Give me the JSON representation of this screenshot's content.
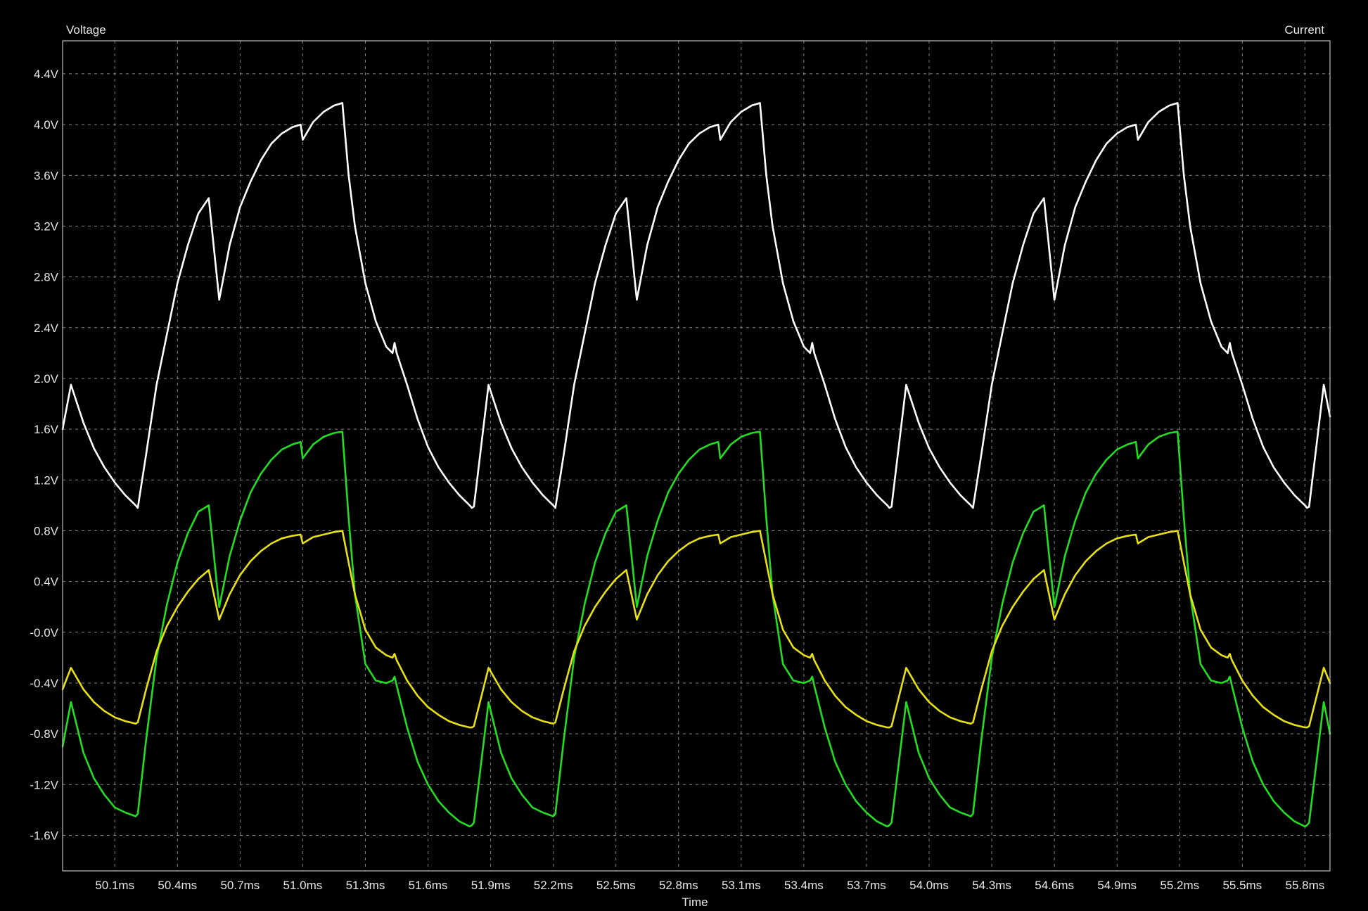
{
  "chart_data": {
    "type": "line",
    "title": "",
    "xlabel": "Time",
    "ylabel": "Voltage",
    "y2label": "Current",
    "xlim": [
      49.85,
      55.92
    ],
    "ylim": [
      -1.88,
      4.66
    ],
    "grid": true,
    "background": "#000000",
    "xticks": [
      50.1,
      50.4,
      50.7,
      51.0,
      51.3,
      51.6,
      51.9,
      52.2,
      52.5,
      52.8,
      53.1,
      53.4,
      53.7,
      54.0,
      54.3,
      54.6,
      54.9,
      55.2,
      55.5,
      55.8
    ],
    "xtick_labels": [
      "50.1ms",
      "50.4ms",
      "50.7ms",
      "51.0ms",
      "51.3ms",
      "51.6ms",
      "51.9ms",
      "52.2ms",
      "52.5ms",
      "52.8ms",
      "53.1ms",
      "53.4ms",
      "53.7ms",
      "54.0ms",
      "54.3ms",
      "54.6ms",
      "54.9ms",
      "55.2ms",
      "55.5ms",
      "55.8ms"
    ],
    "yticks": [
      4.4,
      4.0,
      3.6,
      3.2,
      2.8,
      2.4,
      2.0,
      1.6,
      1.2,
      0.8,
      0.4,
      0.0,
      -0.4,
      -0.8,
      -1.2,
      -1.6
    ],
    "ytick_labels": [
      "4.4V",
      "4.0V",
      "3.6V",
      "3.2V",
      "2.8V",
      "2.4V",
      "2.0V",
      "1.6V",
      "1.2V",
      "0.8V",
      "0.4V",
      "-0.0V",
      "-0.4V",
      "-0.8V",
      "-1.2V",
      "-1.6V"
    ],
    "series": [
      {
        "color": "#ffffff",
        "x": [
          49.85,
          49.89,
          49.95,
          50.0,
          50.05,
          50.1,
          50.15,
          50.2,
          50.21,
          50.25,
          50.3,
          50.35,
          50.4,
          50.45,
          50.5,
          50.55,
          50.6,
          50.65,
          50.7,
          50.75,
          50.8,
          50.85,
          50.9,
          50.95,
          50.99,
          51.0,
          51.05,
          51.1,
          51.15,
          51.19,
          51.22,
          51.25,
          51.3,
          51.35,
          51.4,
          51.43,
          51.44,
          51.45,
          51.5,
          51.55,
          51.6,
          51.65,
          51.7,
          51.75,
          51.8,
          51.81,
          51.82,
          51.89,
          51.95,
          52.0,
          52.05,
          52.1,
          52.15,
          52.2,
          52.21,
          52.25,
          52.3,
          52.35,
          52.4,
          52.45,
          52.5,
          52.55,
          52.6,
          52.65,
          52.7,
          52.75,
          52.8,
          52.85,
          52.9,
          52.95,
          52.99,
          53.0,
          53.05,
          53.1,
          53.15,
          53.19,
          53.22,
          53.25,
          53.3,
          53.35,
          53.4,
          53.43,
          53.44,
          53.45,
          53.5,
          53.55,
          53.6,
          53.65,
          53.7,
          53.75,
          53.8,
          53.81,
          53.82,
          53.89,
          53.95,
          54.0,
          54.05,
          54.1,
          54.15,
          54.2,
          54.21,
          54.25,
          54.3,
          54.35,
          54.4,
          54.45,
          54.5,
          54.55,
          54.6,
          54.65,
          54.7,
          54.75,
          54.8,
          54.85,
          54.9,
          54.95,
          54.99,
          55.0,
          55.05,
          55.1,
          55.15,
          55.19,
          55.22,
          55.25,
          55.3,
          55.35,
          55.4,
          55.43,
          55.44,
          55.45,
          55.5,
          55.55,
          55.6,
          55.65,
          55.7,
          55.75,
          55.8,
          55.81,
          55.82,
          55.89,
          55.92
        ],
        "y": [
          1.6,
          1.95,
          1.65,
          1.45,
          1.3,
          1.18,
          1.08,
          1.0,
          0.98,
          1.4,
          1.95,
          2.35,
          2.75,
          3.05,
          3.3,
          3.42,
          2.62,
          3.05,
          3.35,
          3.55,
          3.72,
          3.85,
          3.93,
          3.98,
          4.0,
          3.88,
          4.02,
          4.1,
          4.15,
          4.17,
          3.6,
          3.2,
          2.75,
          2.45,
          2.25,
          2.2,
          2.28,
          2.2,
          1.95,
          1.68,
          1.46,
          1.3,
          1.18,
          1.08,
          1.0,
          0.98,
          0.99,
          1.95,
          1.65,
          1.45,
          1.3,
          1.18,
          1.08,
          1.0,
          0.98,
          1.4,
          1.95,
          2.35,
          2.75,
          3.05,
          3.3,
          3.42,
          2.62,
          3.05,
          3.35,
          3.55,
          3.72,
          3.85,
          3.93,
          3.98,
          4.0,
          3.88,
          4.02,
          4.1,
          4.15,
          4.17,
          3.6,
          3.2,
          2.75,
          2.45,
          2.25,
          2.2,
          2.28,
          2.2,
          1.95,
          1.68,
          1.46,
          1.3,
          1.18,
          1.08,
          1.0,
          0.98,
          0.99,
          1.95,
          1.65,
          1.45,
          1.3,
          1.18,
          1.08,
          1.0,
          0.98,
          1.4,
          1.95,
          2.35,
          2.75,
          3.05,
          3.3,
          3.42,
          2.62,
          3.05,
          3.35,
          3.55,
          3.72,
          3.85,
          3.93,
          3.98,
          4.0,
          3.88,
          4.02,
          4.1,
          4.15,
          4.17,
          3.6,
          3.2,
          2.75,
          2.45,
          2.25,
          2.2,
          2.28,
          2.2,
          1.95,
          1.68,
          1.46,
          1.3,
          1.18,
          1.08,
          1.0,
          0.98,
          0.99,
          1.95,
          1.7
        ]
      },
      {
        "color": "#22dd22",
        "x": [
          49.85,
          49.89,
          49.95,
          50.0,
          50.05,
          50.1,
          50.15,
          50.2,
          50.21,
          50.25,
          50.3,
          50.35,
          50.4,
          50.45,
          50.5,
          50.55,
          50.6,
          50.65,
          50.7,
          50.75,
          50.8,
          50.85,
          50.9,
          50.95,
          50.99,
          51.0,
          51.05,
          51.1,
          51.15,
          51.19,
          51.22,
          51.25,
          51.3,
          51.35,
          51.4,
          51.43,
          51.44,
          51.45,
          51.5,
          51.55,
          51.6,
          51.65,
          51.7,
          51.75,
          51.8,
          51.81,
          51.82,
          51.89,
          51.95,
          52.0,
          52.05,
          52.1,
          52.15,
          52.2,
          52.21,
          52.25,
          52.3,
          52.35,
          52.4,
          52.45,
          52.5,
          52.55,
          52.6,
          52.65,
          52.7,
          52.75,
          52.8,
          52.85,
          52.9,
          52.95,
          52.99,
          53.0,
          53.05,
          53.1,
          53.15,
          53.19,
          53.22,
          53.25,
          53.3,
          53.35,
          53.4,
          53.43,
          53.44,
          53.45,
          53.5,
          53.55,
          53.6,
          53.65,
          53.7,
          53.75,
          53.8,
          53.81,
          53.82,
          53.89,
          53.95,
          54.0,
          54.05,
          54.1,
          54.15,
          54.2,
          54.21,
          54.25,
          54.3,
          54.35,
          54.4,
          54.45,
          54.5,
          54.55,
          54.6,
          54.65,
          54.7,
          54.75,
          54.8,
          54.85,
          54.9,
          54.95,
          54.99,
          55.0,
          55.05,
          55.1,
          55.15,
          55.19,
          55.22,
          55.25,
          55.3,
          55.35,
          55.4,
          55.43,
          55.44,
          55.45,
          55.5,
          55.55,
          55.6,
          55.65,
          55.7,
          55.75,
          55.8,
          55.81,
          55.82,
          55.89,
          55.92
        ],
        "y": [
          -0.9,
          -0.55,
          -0.95,
          -1.15,
          -1.28,
          -1.38,
          -1.42,
          -1.45,
          -1.43,
          -0.85,
          -0.2,
          0.22,
          0.55,
          0.78,
          0.95,
          1.0,
          0.2,
          0.6,
          0.88,
          1.1,
          1.25,
          1.36,
          1.44,
          1.48,
          1.5,
          1.37,
          1.48,
          1.54,
          1.57,
          1.58,
          0.9,
          0.3,
          -0.25,
          -0.38,
          -0.4,
          -0.38,
          -0.35,
          -0.42,
          -0.75,
          -1.02,
          -1.2,
          -1.33,
          -1.42,
          -1.49,
          -1.53,
          -1.52,
          -1.5,
          -0.55,
          -0.95,
          -1.15,
          -1.28,
          -1.38,
          -1.42,
          -1.45,
          -1.43,
          -0.85,
          -0.2,
          0.22,
          0.55,
          0.78,
          0.95,
          1.0,
          0.2,
          0.6,
          0.88,
          1.1,
          1.25,
          1.36,
          1.44,
          1.48,
          1.5,
          1.37,
          1.48,
          1.54,
          1.57,
          1.58,
          0.9,
          0.3,
          -0.25,
          -0.38,
          -0.4,
          -0.38,
          -0.35,
          -0.42,
          -0.75,
          -1.02,
          -1.2,
          -1.33,
          -1.42,
          -1.49,
          -1.53,
          -1.52,
          -1.5,
          -0.55,
          -0.95,
          -1.15,
          -1.28,
          -1.38,
          -1.42,
          -1.45,
          -1.43,
          -0.85,
          -0.2,
          0.22,
          0.55,
          0.78,
          0.95,
          1.0,
          0.2,
          0.6,
          0.88,
          1.1,
          1.25,
          1.36,
          1.44,
          1.48,
          1.5,
          1.37,
          1.48,
          1.54,
          1.57,
          1.58,
          0.9,
          0.3,
          -0.25,
          -0.38,
          -0.4,
          -0.38,
          -0.35,
          -0.42,
          -0.75,
          -1.02,
          -1.2,
          -1.33,
          -1.42,
          -1.49,
          -1.53,
          -1.52,
          -1.5,
          -0.55,
          -0.8
        ]
      },
      {
        "color": "#e8e010",
        "x": [
          49.85,
          49.89,
          49.95,
          50.0,
          50.05,
          50.1,
          50.15,
          50.2,
          50.21,
          50.25,
          50.3,
          50.35,
          50.4,
          50.45,
          50.5,
          50.55,
          50.6,
          50.65,
          50.7,
          50.75,
          50.8,
          50.85,
          50.9,
          50.95,
          50.99,
          51.0,
          51.05,
          51.1,
          51.15,
          51.19,
          51.22,
          51.25,
          51.3,
          51.35,
          51.4,
          51.43,
          51.44,
          51.45,
          51.5,
          51.55,
          51.6,
          51.65,
          51.7,
          51.75,
          51.8,
          51.81,
          51.82,
          51.89,
          51.95,
          52.0,
          52.05,
          52.1,
          52.15,
          52.2,
          52.21,
          52.25,
          52.3,
          52.35,
          52.4,
          52.45,
          52.5,
          52.55,
          52.6,
          52.65,
          52.7,
          52.75,
          52.8,
          52.85,
          52.9,
          52.95,
          52.99,
          53.0,
          53.05,
          53.1,
          53.15,
          53.19,
          53.22,
          53.25,
          53.3,
          53.35,
          53.4,
          53.43,
          53.44,
          53.45,
          53.5,
          53.55,
          53.6,
          53.65,
          53.7,
          53.75,
          53.8,
          53.81,
          53.82,
          53.89,
          53.95,
          54.0,
          54.05,
          54.1,
          54.15,
          54.2,
          54.21,
          54.25,
          54.3,
          54.35,
          54.4,
          54.45,
          54.5,
          54.55,
          54.6,
          54.65,
          54.7,
          54.75,
          54.8,
          54.85,
          54.9,
          54.95,
          54.99,
          55.0,
          55.05,
          55.1,
          55.15,
          55.19,
          55.22,
          55.25,
          55.3,
          55.35,
          55.4,
          55.43,
          55.44,
          55.45,
          55.5,
          55.55,
          55.6,
          55.65,
          55.7,
          55.75,
          55.8,
          55.81,
          55.82,
          55.89,
          55.92
        ],
        "y": [
          -0.45,
          -0.28,
          -0.45,
          -0.55,
          -0.62,
          -0.67,
          -0.7,
          -0.72,
          -0.71,
          -0.45,
          -0.15,
          0.05,
          0.2,
          0.32,
          0.42,
          0.49,
          0.1,
          0.3,
          0.45,
          0.56,
          0.64,
          0.7,
          0.74,
          0.76,
          0.77,
          0.7,
          0.75,
          0.77,
          0.79,
          0.8,
          0.55,
          0.3,
          0.02,
          -0.12,
          -0.18,
          -0.2,
          -0.17,
          -0.22,
          -0.38,
          -0.5,
          -0.59,
          -0.65,
          -0.7,
          -0.73,
          -0.75,
          -0.75,
          -0.74,
          -0.28,
          -0.45,
          -0.55,
          -0.62,
          -0.67,
          -0.7,
          -0.72,
          -0.71,
          -0.45,
          -0.15,
          0.05,
          0.2,
          0.32,
          0.42,
          0.49,
          0.1,
          0.3,
          0.45,
          0.56,
          0.64,
          0.7,
          0.74,
          0.76,
          0.77,
          0.7,
          0.75,
          0.77,
          0.79,
          0.8,
          0.55,
          0.3,
          0.02,
          -0.12,
          -0.18,
          -0.2,
          -0.17,
          -0.22,
          -0.38,
          -0.5,
          -0.59,
          -0.65,
          -0.7,
          -0.73,
          -0.75,
          -0.75,
          -0.74,
          -0.28,
          -0.45,
          -0.55,
          -0.62,
          -0.67,
          -0.7,
          -0.72,
          -0.71,
          -0.45,
          -0.15,
          0.05,
          0.2,
          0.32,
          0.42,
          0.49,
          0.1,
          0.3,
          0.45,
          0.56,
          0.64,
          0.7,
          0.74,
          0.76,
          0.77,
          0.7,
          0.75,
          0.77,
          0.79,
          0.8,
          0.55,
          0.3,
          0.02,
          -0.12,
          -0.18,
          -0.2,
          -0.17,
          -0.22,
          -0.38,
          -0.5,
          -0.59,
          -0.65,
          -0.7,
          -0.73,
          -0.75,
          -0.75,
          -0.74,
          -0.28,
          -0.4
        ]
      }
    ]
  }
}
